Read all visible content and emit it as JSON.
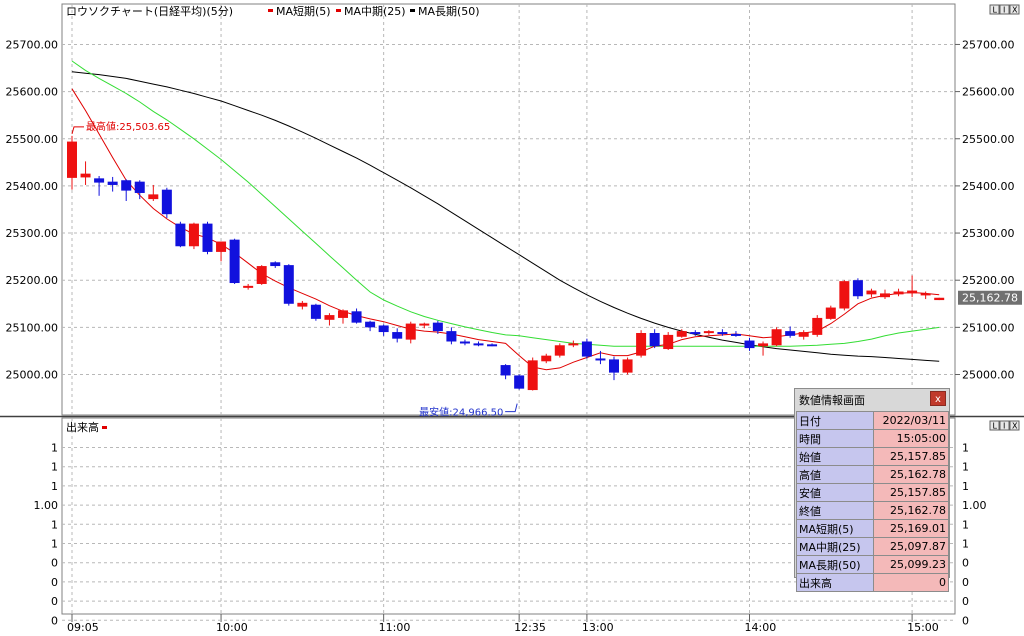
{
  "chart_data": {
    "type": "candlestick",
    "title": "ロウソクチャート(日経平均)(5分)",
    "legend": [
      {
        "label": "MA短期(5)",
        "color": "#e00000"
      },
      {
        "label": "MA中期(25)",
        "color": "#e00000"
      },
      {
        "label": "MA長期(50)",
        "color": "#000000"
      }
    ],
    "colors": {
      "up": "#ee1111",
      "down": "#1111dd",
      "ma_short": "#e00000",
      "ma_mid": "#33dd33",
      "ma_long": "#000000",
      "grid": "#b8b8b8"
    },
    "ylim": [
      24920,
      25760
    ],
    "y_ticks": [
      25000,
      25100,
      25200,
      25300,
      25400,
      25500,
      25600,
      25700
    ],
    "y_tick_labels": [
      "25000.00",
      "25100.00",
      "25200.00",
      "25300.00",
      "25400.00",
      "25500.00",
      "25600.00",
      "25700.00"
    ],
    "x_ticks": [
      {
        "i": 0,
        "label": "09:05"
      },
      {
        "i": 11,
        "label": "10:00"
      },
      {
        "i": 23,
        "label": "11:00"
      },
      {
        "i": 33,
        "label": "12:35"
      },
      {
        "i": 38,
        "label": "13:00"
      },
      {
        "i": 50,
        "label": "14:00"
      },
      {
        "i": 62,
        "label": "15:00"
      }
    ],
    "candles": [
      {
        "o": 25417,
        "h": 25506,
        "l": 25392,
        "c": 25494
      },
      {
        "o": 25418,
        "h": 25452,
        "l": 25402,
        "c": 25426
      },
      {
        "o": 25416,
        "h": 25421,
        "l": 25379,
        "c": 25407
      },
      {
        "o": 25409,
        "h": 25419,
        "l": 25388,
        "c": 25402
      },
      {
        "o": 25412,
        "h": 25414,
        "l": 25368,
        "c": 25390
      },
      {
        "o": 25409,
        "h": 25412,
        "l": 25372,
        "c": 25385
      },
      {
        "o": 25372,
        "h": 25402,
        "l": 25368,
        "c": 25382
      },
      {
        "o": 25392,
        "h": 25396,
        "l": 25332,
        "c": 25340
      },
      {
        "o": 25320,
        "h": 25324,
        "l": 25270,
        "c": 25272
      },
      {
        "o": 25272,
        "h": 25322,
        "l": 25266,
        "c": 25320
      },
      {
        "o": 25320,
        "h": 25324,
        "l": 25255,
        "c": 25260
      },
      {
        "o": 25260,
        "h": 25282,
        "l": 25240,
        "c": 25282
      },
      {
        "o": 25286,
        "h": 25288,
        "l": 25192,
        "c": 25194
      },
      {
        "o": 25186,
        "h": 25192,
        "l": 25180,
        "c": 25188
      },
      {
        "o": 25192,
        "h": 25232,
        "l": 25190,
        "c": 25230
      },
      {
        "o": 25238,
        "h": 25240,
        "l": 25226,
        "c": 25230
      },
      {
        "o": 25232,
        "h": 25234,
        "l": 25146,
        "c": 25150
      },
      {
        "o": 25144,
        "h": 25156,
        "l": 25138,
        "c": 25152
      },
      {
        "o": 25148,
        "h": 25150,
        "l": 25114,
        "c": 25118
      },
      {
        "o": 25116,
        "h": 25130,
        "l": 25104,
        "c": 25126
      },
      {
        "o": 25120,
        "h": 25138,
        "l": 25108,
        "c": 25136
      },
      {
        "o": 25134,
        "h": 25140,
        "l": 25108,
        "c": 25110
      },
      {
        "o": 25112,
        "h": 25114,
        "l": 25092,
        "c": 25100
      },
      {
        "o": 25104,
        "h": 25106,
        "l": 25082,
        "c": 25090
      },
      {
        "o": 25090,
        "h": 25098,
        "l": 25068,
        "c": 25076
      },
      {
        "o": 25074,
        "h": 25112,
        "l": 25066,
        "c": 25108
      },
      {
        "o": 25104,
        "h": 25110,
        "l": 25098,
        "c": 25108
      },
      {
        "o": 25110,
        "h": 25114,
        "l": 25086,
        "c": 25092
      },
      {
        "o": 25092,
        "h": 25100,
        "l": 25064,
        "c": 25070
      },
      {
        "o": 25070,
        "h": 25074,
        "l": 25062,
        "c": 25066
      },
      {
        "o": 25066,
        "h": 25070,
        "l": 25060,
        "c": 25064
      },
      {
        "o": 25064,
        "h": 25066,
        "l": 25060,
        "c": 25063
      },
      {
        "o": 25020,
        "h": 25022,
        "l": 24990,
        "c": 24998
      },
      {
        "o": 24998,
        "h": 25000,
        "l": 24968,
        "c": 24970
      },
      {
        "o": 24967,
        "h": 25036,
        "l": 24966,
        "c": 25030
      },
      {
        "o": 25028,
        "h": 25044,
        "l": 25024,
        "c": 25040
      },
      {
        "o": 25040,
        "h": 25066,
        "l": 25036,
        "c": 25062
      },
      {
        "o": 25064,
        "h": 25072,
        "l": 25058,
        "c": 25066
      },
      {
        "o": 25070,
        "h": 25076,
        "l": 25034,
        "c": 25038
      },
      {
        "o": 25034,
        "h": 25050,
        "l": 25022,
        "c": 25032
      },
      {
        "o": 25032,
        "h": 25038,
        "l": 24988,
        "c": 25004
      },
      {
        "o": 25004,
        "h": 25036,
        "l": 25000,
        "c": 25032
      },
      {
        "o": 25040,
        "h": 25094,
        "l": 25036,
        "c": 25088
      },
      {
        "o": 25088,
        "h": 25096,
        "l": 25056,
        "c": 25060
      },
      {
        "o": 25054,
        "h": 25090,
        "l": 25052,
        "c": 25084
      },
      {
        "o": 25080,
        "h": 25096,
        "l": 25078,
        "c": 25092
      },
      {
        "o": 25090,
        "h": 25094,
        "l": 25082,
        "c": 25088
      },
      {
        "o": 25090,
        "h": 25094,
        "l": 25084,
        "c": 25092
      },
      {
        "o": 25090,
        "h": 25096,
        "l": 25082,
        "c": 25086
      },
      {
        "o": 25086,
        "h": 25092,
        "l": 25080,
        "c": 25084
      },
      {
        "o": 25072,
        "h": 25078,
        "l": 25050,
        "c": 25056
      },
      {
        "o": 25060,
        "h": 25070,
        "l": 25040,
        "c": 25066
      },
      {
        "o": 25062,
        "h": 25100,
        "l": 25060,
        "c": 25096
      },
      {
        "o": 25092,
        "h": 25102,
        "l": 25078,
        "c": 25082
      },
      {
        "o": 25080,
        "h": 25094,
        "l": 25074,
        "c": 25090
      },
      {
        "o": 25084,
        "h": 25126,
        "l": 25080,
        "c": 25120
      },
      {
        "o": 25118,
        "h": 25146,
        "l": 25116,
        "c": 25142
      },
      {
        "o": 25140,
        "h": 25200,
        "l": 25136,
        "c": 25198
      },
      {
        "o": 25200,
        "h": 25204,
        "l": 25160,
        "c": 25166
      },
      {
        "o": 25170,
        "h": 25182,
        "l": 25164,
        "c": 25178
      },
      {
        "o": 25164,
        "h": 25180,
        "l": 25160,
        "c": 25172
      },
      {
        "o": 25170,
        "h": 25182,
        "l": 25166,
        "c": 25176
      },
      {
        "o": 25172,
        "h": 25210,
        "l": 25164,
        "c": 25178
      },
      {
        "o": 25168,
        "h": 25176,
        "l": 25160,
        "c": 25172
      },
      {
        "o": 25157.85,
        "h": 25162.78,
        "l": 25157.85,
        "c": 25162.78
      }
    ],
    "ma_short": [
      25606,
      25560,
      25510,
      25460,
      25412,
      25380,
      25352,
      25330,
      25312,
      25298,
      25290,
      25276,
      25258,
      25236,
      25214,
      25198,
      25184,
      25172,
      25160,
      25146,
      25134,
      25125,
      25118,
      25112,
      25104,
      25096,
      25092,
      25090,
      25086,
      25080,
      25074,
      25070,
      25066,
      25040,
      25016,
      25010,
      25014,
      25026,
      25036,
      25046,
      25040,
      25040,
      25048,
      25060,
      25064,
      25074,
      25080,
      25082,
      25084,
      25086,
      25082,
      25078,
      25080,
      25084,
      25088,
      25092,
      25108,
      25128,
      25150,
      25162,
      25168,
      25172,
      25174,
      25172,
      25169
    ],
    "ma_mid": [
      25665,
      25645,
      25628,
      25612,
      25596,
      25578,
      25558,
      25540,
      25520,
      25500,
      25478,
      25456,
      25432,
      25408,
      25382,
      25356,
      25330,
      25304,
      25278,
      25252,
      25226,
      25200,
      25175,
      25158,
      25145,
      25133,
      25123,
      25115,
      25108,
      25101,
      25095,
      25089,
      25084,
      25082,
      25078,
      25074,
      25070,
      25066,
      25064,
      25062,
      25060,
      25060,
      25060,
      25060,
      25060,
      25060,
      25060,
      25060,
      25060,
      25060,
      25060,
      25060,
      25060,
      25060,
      25061,
      25062,
      25064,
      25066,
      25070,
      25075,
      25082,
      25088,
      25092,
      25096,
      25100
    ],
    "ma_long": [
      25642,
      25639,
      25636,
      25632,
      25628,
      25622,
      25616,
      25610,
      25603,
      25596,
      25588,
      25580,
      25570,
      25560,
      25550,
      25539,
      25527,
      25514,
      25501,
      25487,
      25473,
      25459,
      25444,
      25428,
      25412,
      25396,
      25379,
      25362,
      25344,
      25326,
      25308,
      25290,
      25272,
      25254,
      25236,
      25218,
      25200,
      25184,
      25169,
      25155,
      25142,
      25130,
      25119,
      25109,
      25100,
      25092,
      25085,
      25079,
      25073,
      25068,
      25063,
      25059,
      25055,
      25052,
      25049,
      25046,
      25043,
      25041,
      25039,
      25038,
      25036,
      25034,
      25032,
      25030,
      25028
    ],
    "high_marker": {
      "i": 0,
      "label": "最高値:25,503.65"
    },
    "low_marker": {
      "i": 33,
      "label": "最安値:24,966.50"
    },
    "last_price_label": "25,162.78",
    "volume": {
      "title": "出来高",
      "color": "#e00000",
      "y_tick_labels": [
        "1",
        "1",
        "1",
        "1.00",
        "1",
        "1",
        "0",
        "0",
        "0",
        "0"
      ]
    }
  },
  "window_buttons": [
    "L",
    "I",
    "X"
  ],
  "info_panel": {
    "title": "数値情報画面",
    "close_label": "x",
    "rows": [
      {
        "label": "日付",
        "value": "2022/03/11"
      },
      {
        "label": "時間",
        "value": "15:05:00"
      },
      {
        "label": "始値",
        "value": "25,157.85"
      },
      {
        "label": "高値",
        "value": "25,162.78"
      },
      {
        "label": "安値",
        "value": "25,157.85"
      },
      {
        "label": "終値",
        "value": "25,162.78"
      },
      {
        "label": "MA短期(5)",
        "value": "25,169.01"
      },
      {
        "label": "MA中期(25)",
        "value": "25,097.87"
      },
      {
        "label": "MA長期(50)",
        "value": "25,099.23"
      },
      {
        "label": "出来高",
        "value": "0"
      }
    ]
  }
}
